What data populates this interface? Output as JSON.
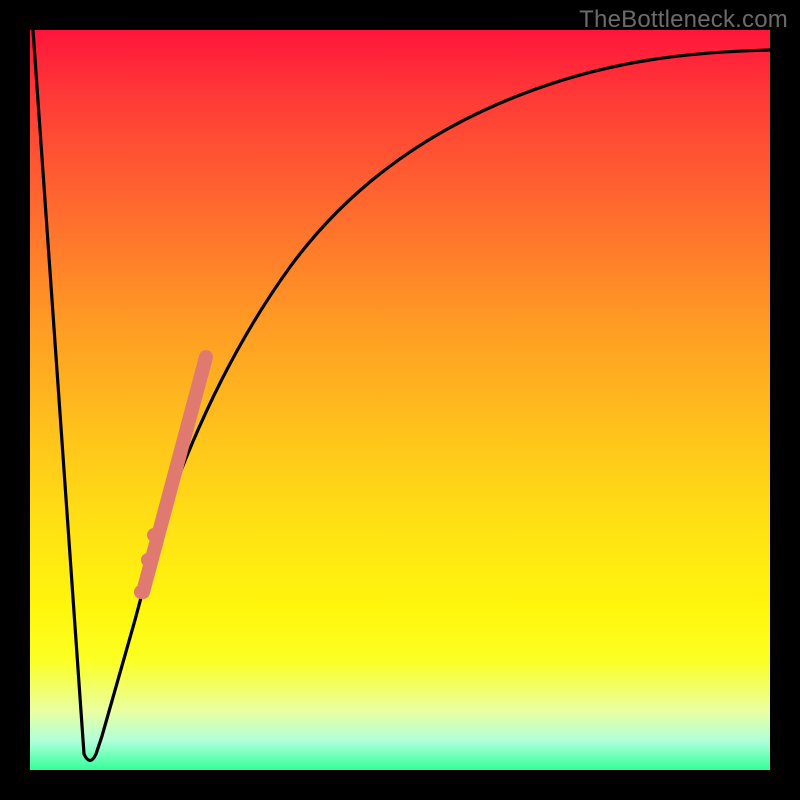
{
  "watermark": "TheBottleneck.com",
  "colors": {
    "background": "#000000",
    "gradient_top": "#ff153b",
    "gradient_bottom": "#33ff9a",
    "curve": "#000000",
    "highlight": "#e07a70"
  },
  "chart_data": {
    "type": "line",
    "title": "",
    "xlabel": "",
    "ylabel": "",
    "xlim": [
      0,
      100
    ],
    "ylim": [
      0,
      100
    ],
    "series": [
      {
        "name": "bottleneck-curve",
        "x": [
          0,
          7,
          8,
          9,
          10,
          14,
          17,
          20,
          25,
          30,
          35,
          40,
          50,
          60,
          70,
          80,
          90,
          100
        ],
        "values": [
          100,
          2,
          1,
          1,
          2,
          20,
          32,
          44,
          58,
          68,
          75,
          80,
          87,
          91,
          93.5,
          95,
          96,
          97
        ]
      }
    ],
    "annotations": {
      "highlight_segment": {
        "name": "thick-salmon-band",
        "x_range": [
          17.5,
          24
        ],
        "y_range": [
          35,
          56
        ]
      },
      "dots": [
        {
          "x": 16.8,
          "y": 32
        },
        {
          "x": 16.0,
          "y": 28.5
        },
        {
          "x": 15.0,
          "y": 24
        }
      ]
    }
  }
}
